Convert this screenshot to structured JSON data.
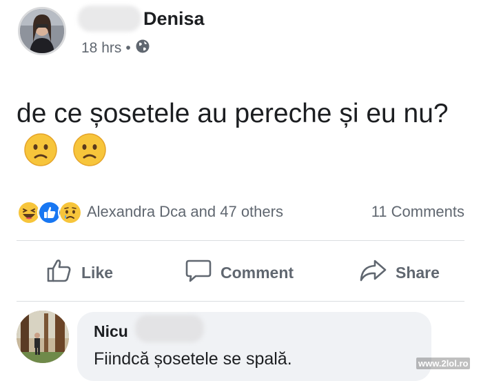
{
  "post": {
    "author": "Denisa",
    "time": "18 hrs",
    "visibility_separator": "•",
    "visibility_icon": "globe-icon",
    "text": "de ce șosetele au pereche și eu nu?",
    "emoji": [
      "frowning-face",
      "frowning-face"
    ]
  },
  "reactions": {
    "icons": [
      "haha",
      "like",
      "sad"
    ],
    "summary": "Alexandra Dca and 47 others",
    "comments": "11 Comments"
  },
  "actions": {
    "like": "Like",
    "comment": "Comment",
    "share": "Share"
  },
  "comment": {
    "author": "Nicu",
    "text": "Fiindcă șosetele se spală."
  },
  "watermark": "www.2lol.ro",
  "colors": {
    "text": "#1c1e21",
    "secondary": "#606770",
    "divider": "#dadde1",
    "bubble": "#f0f2f5",
    "like_blue": "#1877f2",
    "emoji_yellow": "#f7c53b"
  }
}
